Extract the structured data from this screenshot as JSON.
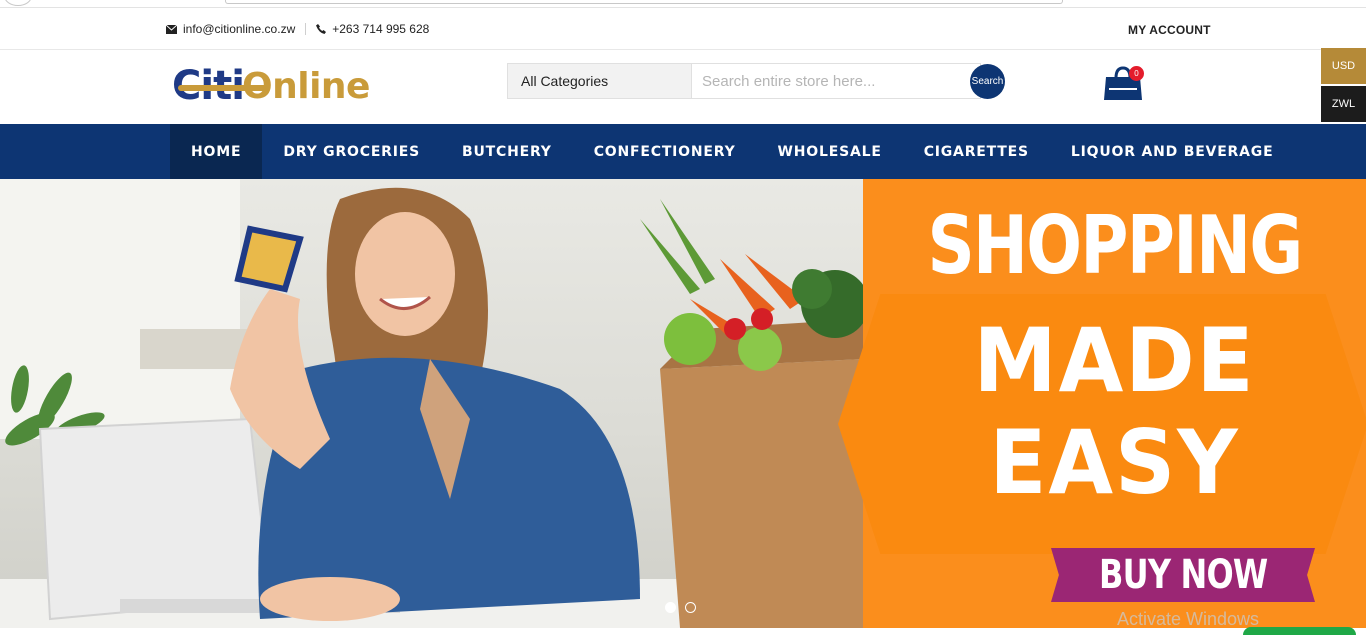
{
  "topbar": {
    "email": "info@citionline.co.zw",
    "phone": "+263 714 995 628",
    "account_label": "MY ACCOUNT"
  },
  "logo": {
    "part1": "Citi",
    "part2": "Online"
  },
  "search": {
    "category_label": "All Categories",
    "placeholder": "Search entire store here...",
    "button_label": "Search"
  },
  "cart": {
    "count": "0",
    "icon": "shopping-bag-icon"
  },
  "currency": {
    "usd": "USD",
    "zwl": "ZWL",
    "active": "USD"
  },
  "nav": {
    "items": [
      {
        "label": "HOME"
      },
      {
        "label": "DRY GROCERIES"
      },
      {
        "label": "BUTCHERY"
      },
      {
        "label": "CONFECTIONERY"
      },
      {
        "label": "WHOLESALE"
      },
      {
        "label": "CIGARETTES"
      },
      {
        "label": "LIQUOR AND BEVERAGE"
      }
    ]
  },
  "banner": {
    "line1": "SHOPPING",
    "line2": "MADE",
    "line3": "EASY",
    "cta": "BUY NOW",
    "watermark": "Activate Windows",
    "slide_count": 2,
    "active_slide": 1
  },
  "colors": {
    "brand_blue": "#0d3573",
    "brand_gold": "#c99b3a",
    "promo_orange": "#fb8e1c",
    "cta_purple": "#9b2674"
  }
}
